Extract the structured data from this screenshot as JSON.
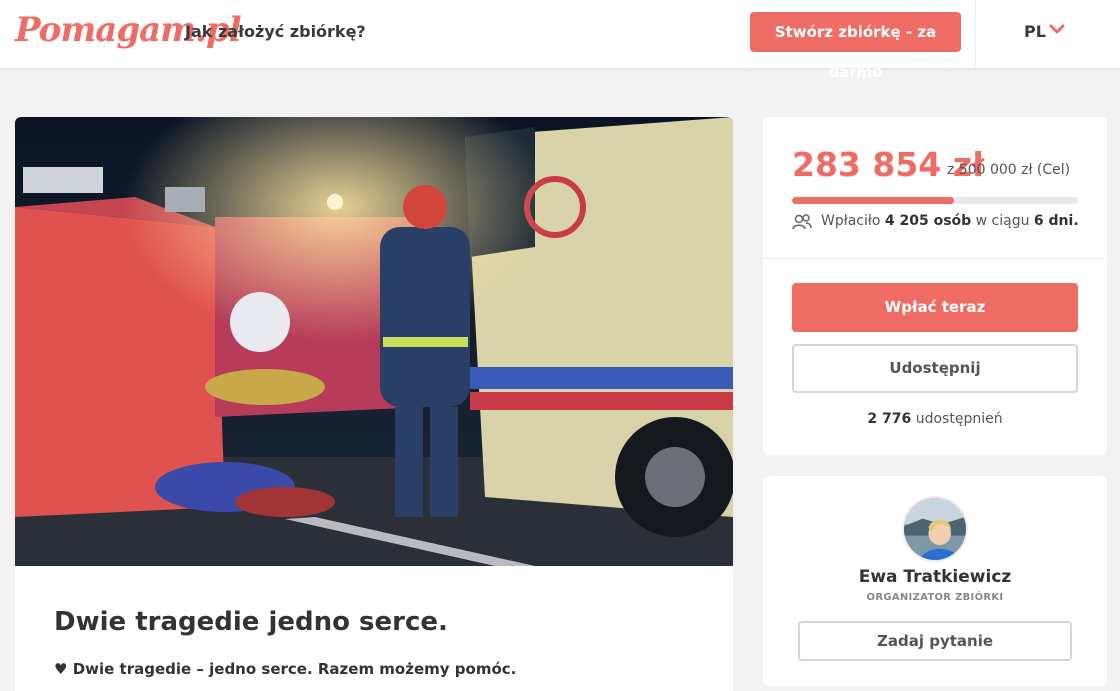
{
  "header": {
    "logo": "Pomagam.pl",
    "howto_link": "Jak założyć zbiórkę?",
    "create_button": "Stwórz zbiórkę - za darmo",
    "language": "PL",
    "language_icon": "chevron-down-icon"
  },
  "campaign": {
    "hero_image_alt": "accident-scene-photo",
    "title": "Dwie tragedie jedno serce.",
    "subtitle": "Dwie tragedie – jedno serce. Razem możemy pomóc."
  },
  "donation": {
    "amount": "283 854 zł",
    "goal_text": "z 500 000 zł (Cel)",
    "progress_fraction": 0.5677,
    "donors_prefix": "Wpłaciło",
    "donors_count": "4 205 osób",
    "donors_mid": "w ciągu",
    "donors_days": "6 dni.",
    "pay_button": "Wpłać teraz",
    "share_button": "Udostępnij",
    "shares_count": "2 776",
    "shares_label": "udostępnień"
  },
  "organizer": {
    "name": "Ewa Tratkiewicz",
    "role": "ORGANIZATOR ZBIÓRKI",
    "ask_button": "Zadaj pytanie"
  },
  "colors": {
    "accent": "#ef6c65",
    "background": "#f2f2f2"
  }
}
